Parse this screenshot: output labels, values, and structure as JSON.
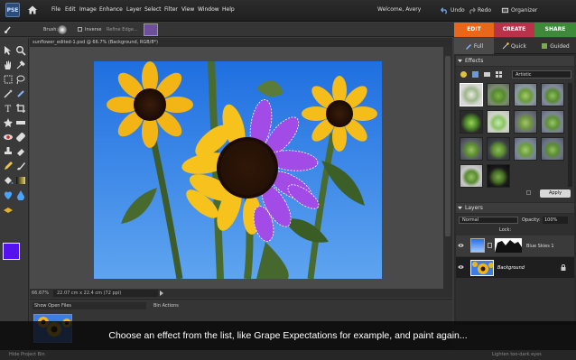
{
  "app": {
    "logo_text": "PSE",
    "menu": [
      "File",
      "Edit",
      "Image",
      "Enhance",
      "Layer",
      "Select",
      "Filter",
      "View",
      "Window",
      "Help"
    ],
    "welcome": "Welcome, Avery",
    "undo": "Undo",
    "redo": "Redo",
    "organizer": "Organizer"
  },
  "options": {
    "brush_label": "Brush:",
    "inverse_label": "Inverse",
    "refine_label": "Refine Edge..."
  },
  "modes": {
    "edit": "EDIT",
    "create": "CREATE",
    "share": "SHARE",
    "colors": {
      "edit": "#e8671b",
      "create": "#c83a52",
      "share": "#3f8a3a"
    }
  },
  "document": {
    "tab_title": "sunflower_edited-1.psd @ 66.7% (Background, RGB/8*)",
    "zoom": "66.67%",
    "size": "22.07 cm x 22.4 cm (72 ppi)"
  },
  "bin": {
    "dropdown": "Show Open Files",
    "actions_label": "Bin Actions"
  },
  "panels": {
    "subtabs": [
      "Full",
      "Quick",
      "Guided"
    ],
    "effects": {
      "header": "Effects",
      "category": "Artistic",
      "apply_label": "Apply"
    },
    "layers": {
      "header": "Layers",
      "blend_mode": "Normal",
      "opacity_label": "Opacity:",
      "opacity_value": "100%",
      "lock_label": "Lock:",
      "items": [
        {
          "name": "Blue Skies 1"
        },
        {
          "name": "Background"
        }
      ]
    }
  },
  "caption": "Choose an effect from the list, like Grape Expectations for example, and paint again...",
  "bottom": {
    "left_label": "Hide Project Bin",
    "right_label": "Lighten too-dark eyes"
  }
}
